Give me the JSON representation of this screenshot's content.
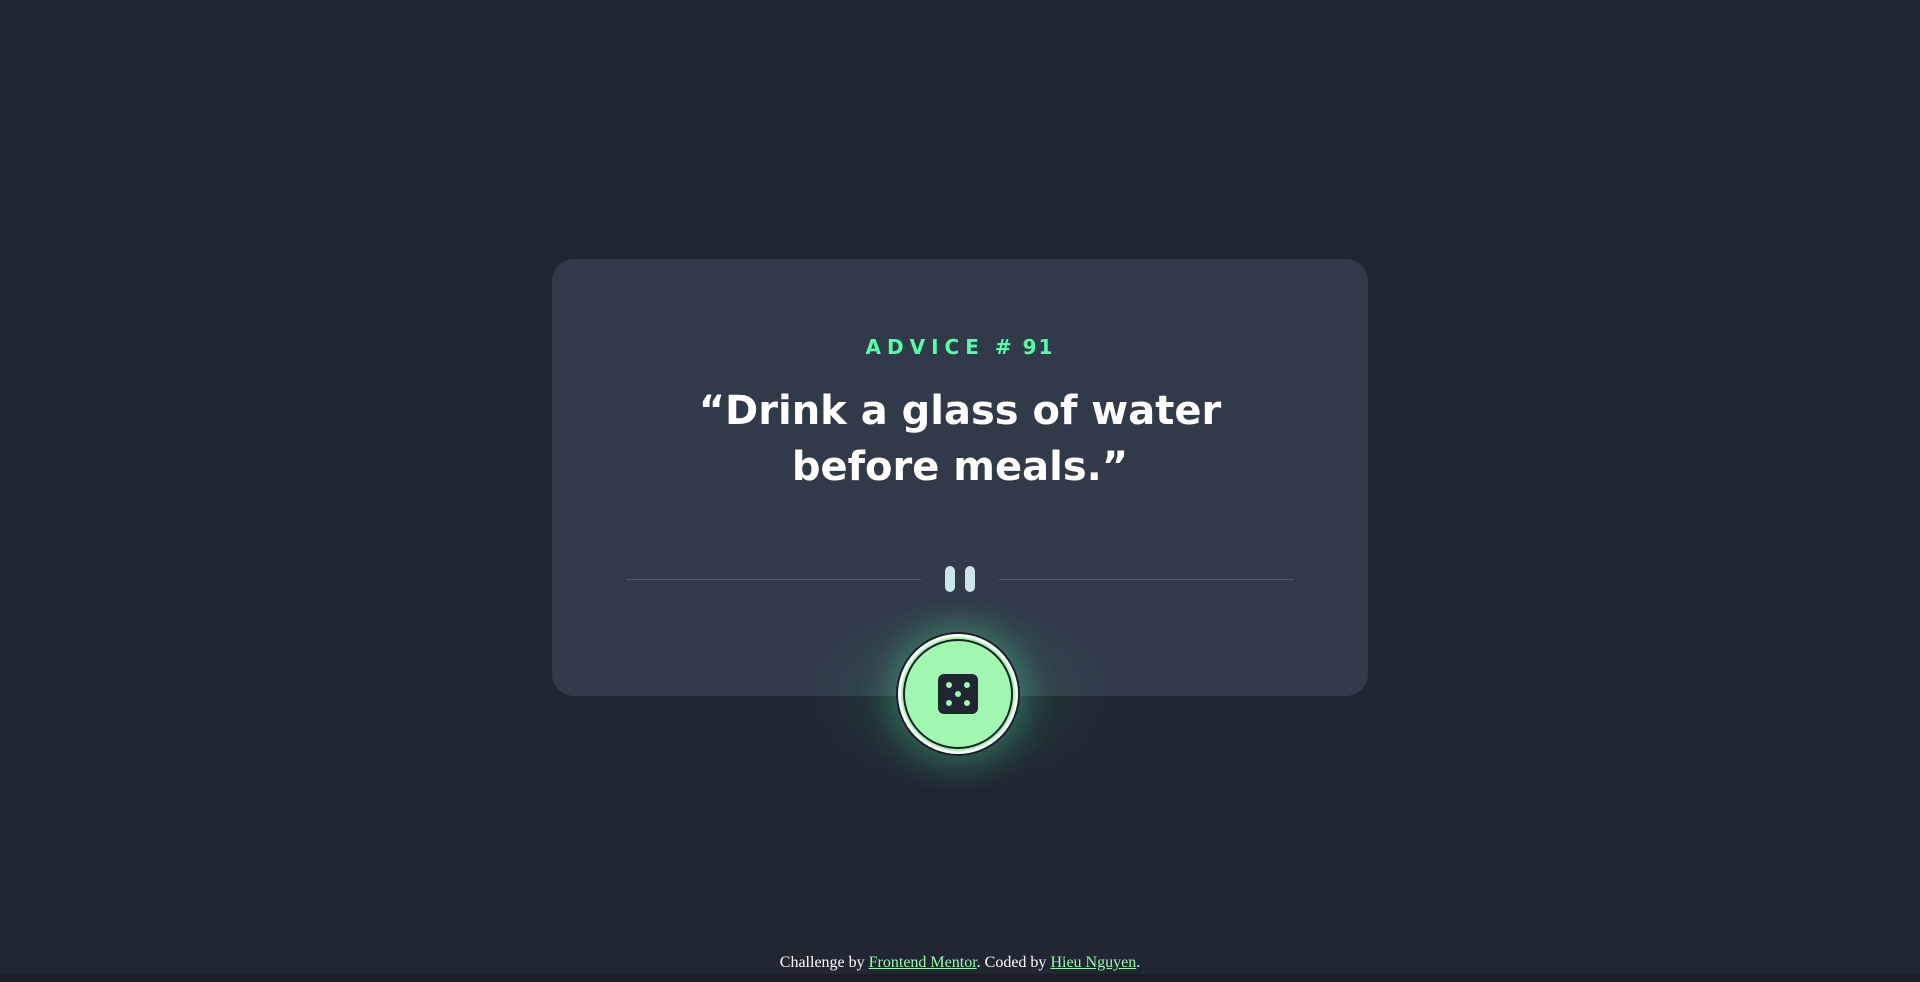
{
  "advice": {
    "label": "ADVICE",
    "number": "# 91",
    "quote": "“Drink a glass of water before meals.”"
  },
  "divider": {
    "icon": "pause-icon"
  },
  "dice_button": {
    "icon": "dice-icon",
    "accent_color": "#a0f7b0"
  },
  "footer": {
    "prefix": "Challenge by ",
    "link1": "Frontend Mentor",
    "middle": ". Coded by ",
    "link2": "Hieu Nguyen",
    "suffix": "."
  },
  "colors": {
    "background": "#202632",
    "card": "#313a49",
    "accent": "#52ffa8",
    "text": "#ffffff",
    "divider": "#4f5d74"
  }
}
